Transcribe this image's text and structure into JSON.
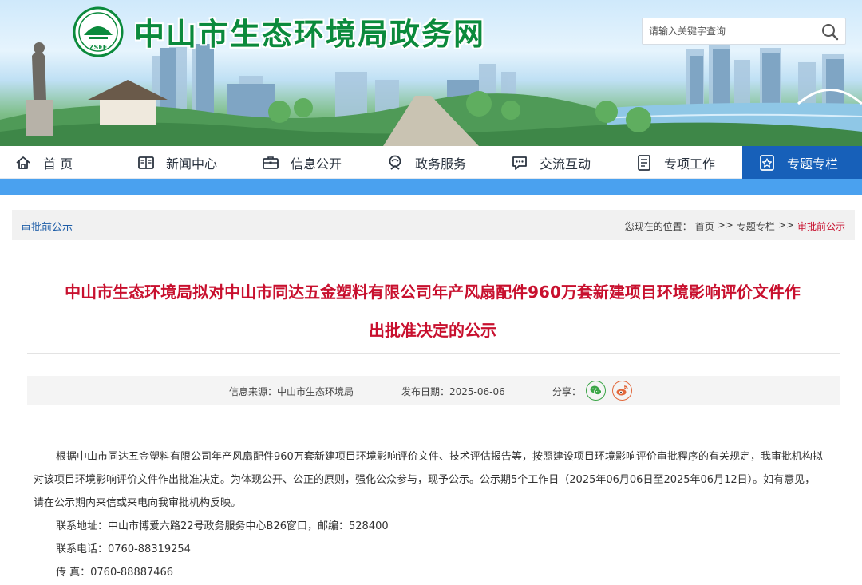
{
  "site": {
    "title": "中山市生态环境局政务网",
    "logo_text": "ZSEE"
  },
  "search": {
    "placeholder": "请输入关键字查询"
  },
  "nav": {
    "items": [
      {
        "label": "首 页",
        "icon": "home-icon"
      },
      {
        "label": "新闻中心",
        "icon": "news-icon"
      },
      {
        "label": "信息公开",
        "icon": "briefcase-icon"
      },
      {
        "label": "政务服务",
        "icon": "service-icon"
      },
      {
        "label": "交流互动",
        "icon": "chat-icon"
      },
      {
        "label": "专项工作",
        "icon": "document-icon"
      },
      {
        "label": "专题专栏",
        "icon": "star-badge-icon"
      }
    ],
    "active_index": 6
  },
  "breadcrumb": {
    "section": "审批前公示",
    "prefix": "您现在的位置：",
    "items": [
      "首页",
      ">>",
      "专题专栏",
      ">>",
      "审批前公示"
    ]
  },
  "article": {
    "title_line1": "中山市生态环境局拟对中山市同达五金塑料有限公司年产风扇配件960万套新建项目环境影响评价文件作",
    "title_line2": "出批准决定的公示",
    "source": "信息来源：中山市生态环境局",
    "date": "发布日期：2025-06-06",
    "share_label": "分享：",
    "paragraph": "根据中山市同达五金塑料有限公司年产风扇配件960万套新建项目环境影响评价文件、技术评估报告等，按照建设项目环境影响评价审批程序的有关规定，我审批机构拟对该项目环境影响评价文件作出批准决定。为体现公开、公正的原则，强化公众参与，现予公示。公示期5个工作日（2025年06月06日至2025年06月12日）。如有意见，请在公示期内来信或来电向我审批机构反映。",
    "address": "联系地址：中山市博爱六路22号政务服务中心B26窗口，邮编：528400",
    "phone": "联系电话：0760-88319254",
    "fax": "传 真：0760-88887466"
  },
  "colors": {
    "brand_green": "#0b8a3c",
    "nav_active": "#1760b9",
    "nav_strip": "#4aa1ef",
    "title_red": "#c8102e",
    "link_blue": "#1f5ea8"
  }
}
